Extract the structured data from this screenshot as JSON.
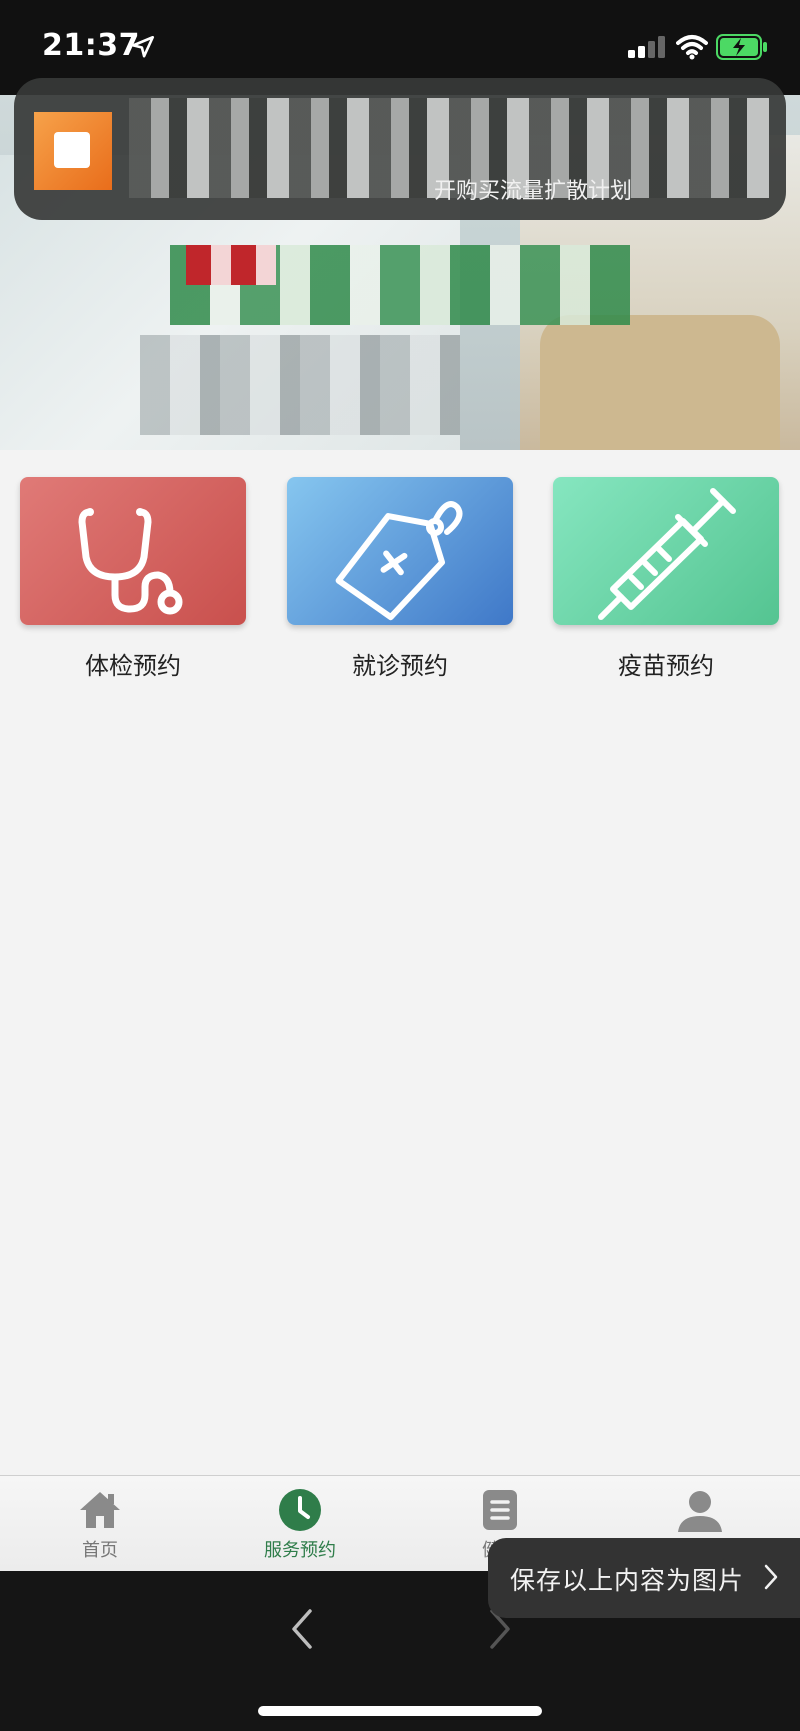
{
  "status_bar": {
    "time": "21:37"
  },
  "notification": {
    "visible_text": "开购买流量扩散计划"
  },
  "services": [
    {
      "label": "体检预约",
      "icon": "stethoscope-icon",
      "color_from": "#e07a77",
      "color_to": "#c9504d"
    },
    {
      "label": "就诊预约",
      "icon": "medical-tag-icon",
      "color_from": "#86c6ef",
      "color_to": "#3f78c8"
    },
    {
      "label": "疫苗预约",
      "icon": "syringe-icon",
      "color_from": "#86e6c0",
      "color_to": "#54c491"
    }
  ],
  "tabbar": {
    "items": [
      {
        "label": "首页",
        "icon": "home-icon"
      },
      {
        "label": "服务预约",
        "icon": "clock-icon",
        "active": true
      },
      {
        "label": "健康",
        "icon": "document-icon"
      },
      {
        "label": "",
        "icon": "user-icon"
      }
    ]
  },
  "toast": {
    "text": "保存以上内容为图片"
  },
  "colors": {
    "accent": "#2f7d4a",
    "tab_text": "#777777",
    "page_bg": "#f3f3f3"
  }
}
